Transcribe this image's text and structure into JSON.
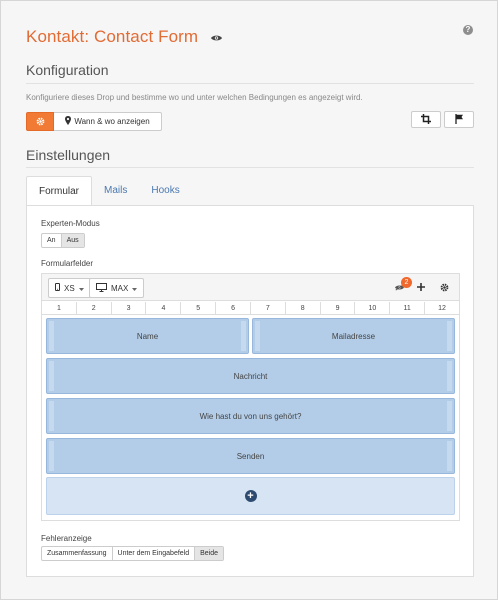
{
  "header": {
    "title": "Kontakt: Contact Form",
    "title_icon": "eye-icon",
    "help_icon": "question-icon",
    "help_glyph": "?"
  },
  "konfiguration": {
    "heading": "Konfiguration",
    "description": "Konfiguriere dieses Drop und bestimme wo und unter welchen Bedingungen es angezeigt wird.",
    "gear_button_icon": "gear-icon",
    "when_where_label": "Wann & wo anzeigen",
    "when_where_icon": "map-marker-icon",
    "crop_icon": "crop-icon",
    "flag_icon": "flag-icon"
  },
  "einstellungen": {
    "heading": "Einstellungen",
    "tabs": [
      {
        "label": "Formular",
        "active": true
      },
      {
        "label": "Mails",
        "active": false
      },
      {
        "label": "Hooks",
        "active": false
      }
    ]
  },
  "form": {
    "expert_mode": {
      "label": "Experten-Modus",
      "options": [
        "An",
        "Aus"
      ],
      "selected": "Aus"
    },
    "fields_label": "Formularfelder",
    "toolbar": {
      "device_small": "XS",
      "device_large": "MAX",
      "hidden_count": "2"
    },
    "ruler": [
      "1",
      "2",
      "3",
      "4",
      "5",
      "6",
      "7",
      "8",
      "9",
      "10",
      "11",
      "12"
    ],
    "fields": {
      "name": "Name",
      "mail": "Mailadresse",
      "message": "Nachricht",
      "source": "Wie hast du von uns gehört?",
      "submit": "Senden"
    },
    "add_glyph": "+",
    "error_display": {
      "label": "Fehleranzeige",
      "options": [
        "Zusammenfassung",
        "Unter dem Eingabefeld",
        "Beide"
      ],
      "selected": "Beide"
    }
  },
  "colors": {
    "accent": "#e26b34",
    "button_orange": "#f17a35",
    "field_blue": "#b3cde8",
    "tab_link": "#4a78b0"
  }
}
